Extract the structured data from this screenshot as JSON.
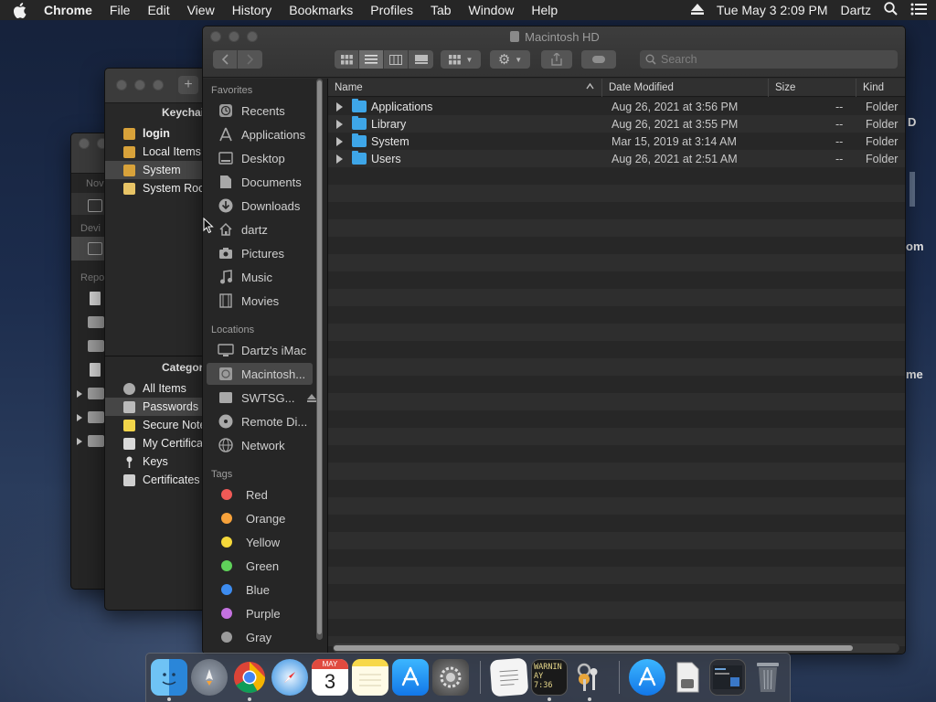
{
  "menubar": {
    "app": "Chrome",
    "items": [
      "File",
      "Edit",
      "View",
      "History",
      "Bookmarks",
      "Profiles",
      "Tab",
      "Window",
      "Help"
    ],
    "clock": "Tue May 3  2:09 PM",
    "user": "Dartz"
  },
  "back_window": {
    "labels": [
      "Nov",
      "Devi",
      "Repo"
    ]
  },
  "keychain": {
    "header": "Keychain",
    "keychains": [
      {
        "label": "login",
        "bold": true
      },
      {
        "label": "Local Items",
        "bold": false
      },
      {
        "label": "System",
        "bold": false,
        "selected": true
      },
      {
        "label": "System Roots",
        "bold": false
      }
    ],
    "category_header": "Category",
    "categories": [
      "All Items",
      "Passwords",
      "Secure Notes",
      "My Certificates",
      "Keys",
      "Certificates"
    ],
    "selected_category": "Passwords"
  },
  "finder": {
    "title": "Macintosh HD",
    "search_placeholder": "Search",
    "sidebar": {
      "favorites_header": "Favorites",
      "favorites": [
        "Recents",
        "Applications",
        "Desktop",
        "Documents",
        "Downloads",
        "dartz",
        "Pictures",
        "Music",
        "Movies"
      ],
      "locations_header": "Locations",
      "locations": [
        "Dartz's iMac",
        "Macintosh...",
        "SWTSG...",
        "Remote Di...",
        "Network"
      ],
      "selected_location": "Macintosh...",
      "tags_header": "Tags",
      "tags": [
        {
          "name": "Red",
          "color": "#f05a56"
        },
        {
          "name": "Orange",
          "color": "#f7a23b"
        },
        {
          "name": "Yellow",
          "color": "#f5d83a"
        },
        {
          "name": "Green",
          "color": "#5fd25a"
        },
        {
          "name": "Blue",
          "color": "#3d8cf0"
        },
        {
          "name": "Purple",
          "color": "#c472e0"
        },
        {
          "name": "Gray",
          "color": "#9b9b9b"
        }
      ]
    },
    "columns": {
      "name": "Name",
      "date": "Date Modified",
      "size": "Size",
      "kind": "Kind"
    },
    "rows": [
      {
        "name": "Applications",
        "date": "Aug 26, 2021 at 3:56 PM",
        "size": "--",
        "kind": "Folder"
      },
      {
        "name": "Library",
        "date": "Aug 26, 2021 at 3:55 PM",
        "size": "--",
        "kind": "Folder"
      },
      {
        "name": "System",
        "date": "Mar 15, 2019 at 3:14 AM",
        "size": "--",
        "kind": "Folder"
      },
      {
        "name": "Users",
        "date": "Aug 26, 2021 at 2:51 AM",
        "size": "--",
        "kind": "Folder"
      }
    ]
  },
  "peek": {
    "a": "D",
    "b": "om",
    "c": "me"
  },
  "dock": {
    "calendar_month": "MAY",
    "calendar_day": "3",
    "console_text_1": "WARNIN",
    "console_text_2": "AY 7:36"
  }
}
